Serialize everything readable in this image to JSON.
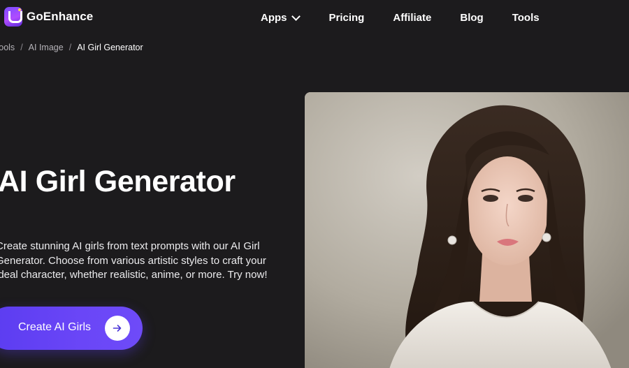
{
  "header": {
    "brand": "GoEnhance",
    "nav": [
      {
        "label": "Apps",
        "has_dropdown": true
      },
      {
        "label": "Pricing"
      },
      {
        "label": "Affiliate"
      },
      {
        "label": "Blog"
      },
      {
        "label": "Tools"
      }
    ]
  },
  "breadcrumb": {
    "items": [
      "Tools",
      "AI Image",
      "AI Girl Generator"
    ],
    "separator": "/"
  },
  "hero": {
    "title": "AI Girl Generator",
    "description": "Create stunning AI girls from text prompts with our AI Girl Generator. Choose from various artistic styles to craft your ideal character, whether realistic, anime, or more. Try now!",
    "cta_label": "Create AI Girls",
    "image_icon": "portrait-image"
  },
  "colors": {
    "background": "#1c1b1d",
    "accent": "#6244f4",
    "text": "#ffffff",
    "muted_text": "#b5b3b8"
  }
}
